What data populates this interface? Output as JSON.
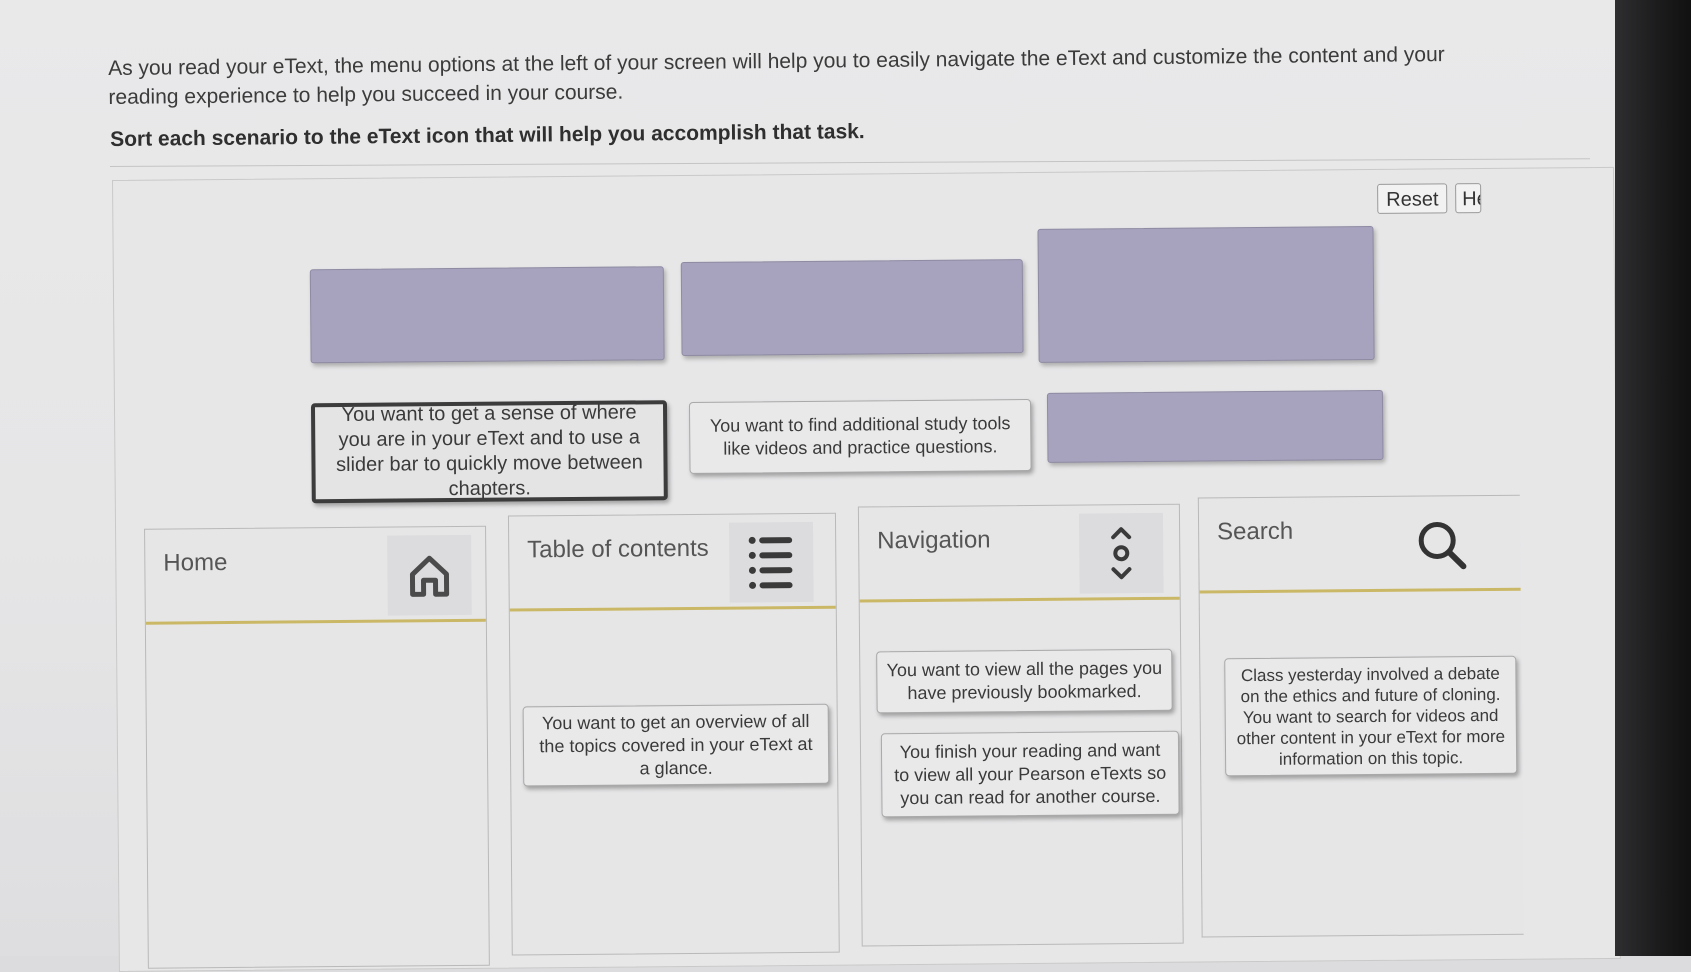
{
  "intro_text": "As you read your eText, the menu options at the left of your screen will help you to easily navigate the eText and customize the content and your reading experience to help you succeed in your course.",
  "instruction": "Sort each scenario to the eText icon that will help you accomplish that task.",
  "toolbar": {
    "reset_label": "Reset",
    "help_label": "He"
  },
  "cards": {
    "slider": "You want to get a sense of where you are in your eText and to use a slider bar to quickly move between chapters.",
    "study_tools": "You want to find additional study tools like videos and practice questions.",
    "overview": "You want to get an overview of all the topics covered in your eText at a glance.",
    "bookmarked": "You want to view all the pages you have previously bookmarked.",
    "pearson_etexts": "You finish your reading and want to view all your Pearson eTexts so you can read for another course.",
    "cloning": "Class yesterday involved a debate on the ethics and future of cloning. You want to search for videos and other content in your eText for more information on this topic."
  },
  "bins": [
    {
      "title": "Home",
      "icon": "home-icon"
    },
    {
      "title": "Table of contents",
      "icon": "list-icon"
    },
    {
      "title": "Navigation",
      "icon": "navigation-icon"
    },
    {
      "title": "Search",
      "icon": "search-icon"
    }
  ],
  "colors": {
    "drop_zone": "#a7a3be",
    "bin_divider": "#cbb866",
    "bezel": "#1b1b1c"
  }
}
